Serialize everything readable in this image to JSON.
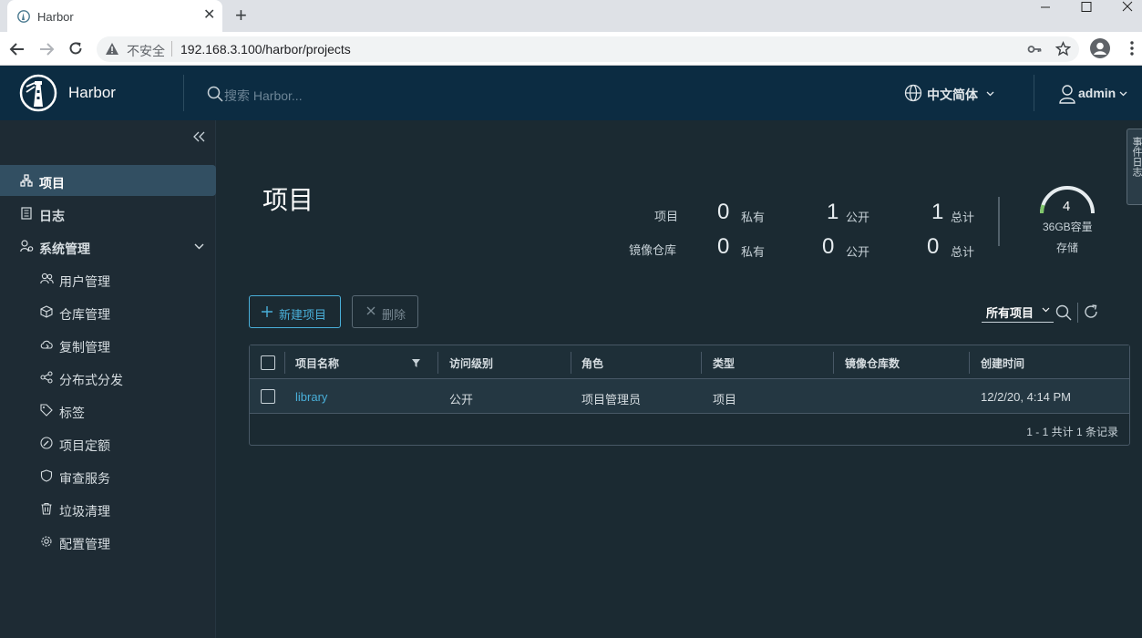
{
  "browser": {
    "tab_title": "Harbor",
    "security_label": "不安全",
    "url": "192.168.3.100/harbor/projects"
  },
  "header": {
    "brand": "Harbor",
    "search_placeholder": "搜索 Harbor...",
    "language": "中文简体",
    "user": "admin",
    "colors": {
      "header_bg": "#0c2c42",
      "accent": "#49afd9"
    }
  },
  "sidebar": {
    "items": [
      {
        "label": "项目",
        "icon": "projects-icon",
        "active": true
      },
      {
        "label": "日志",
        "icon": "logs-icon"
      },
      {
        "label": "系统管理",
        "icon": "admin-icon",
        "expanded": true
      }
    ],
    "sub_items": [
      {
        "label": "用户管理",
        "icon": "users-icon"
      },
      {
        "label": "仓库管理",
        "icon": "registry-icon"
      },
      {
        "label": "复制管理",
        "icon": "replication-icon"
      },
      {
        "label": "分布式分发",
        "icon": "distribution-icon"
      },
      {
        "label": "标签",
        "icon": "tag-icon"
      },
      {
        "label": "项目定额",
        "icon": "quota-icon"
      },
      {
        "label": "审查服务",
        "icon": "shield-icon"
      },
      {
        "label": "垃圾清理",
        "icon": "trash-icon"
      },
      {
        "label": "配置管理",
        "icon": "gear-icon"
      }
    ]
  },
  "main": {
    "title": "项目",
    "stats": {
      "row_projects_label": "项目",
      "row_repos_label": "镜像仓库",
      "projects": {
        "private": "0",
        "public": "1",
        "total": "1"
      },
      "repos": {
        "private": "0",
        "public": "0",
        "total": "0"
      },
      "private_label": "私有",
      "public_label": "公开",
      "total_label": "总计"
    },
    "storage": {
      "value": "4",
      "capacity": "36GB容量",
      "title": "存储"
    },
    "buttons": {
      "new_project": "新建项目",
      "delete": "删除"
    },
    "filter": {
      "selected": "所有项目"
    },
    "table": {
      "columns": [
        "项目名称",
        "访问级别",
        "角色",
        "类型",
        "镜像仓库数",
        "创建时间"
      ],
      "rows": [
        {
          "name": "library",
          "access": "公开",
          "role": "项目管理员",
          "type": "项目",
          "repo_count": "",
          "created": "12/2/20, 4:14 PM"
        }
      ],
      "footer": "1 - 1 共计 1 条记录"
    },
    "side_tab": "事件日志"
  }
}
